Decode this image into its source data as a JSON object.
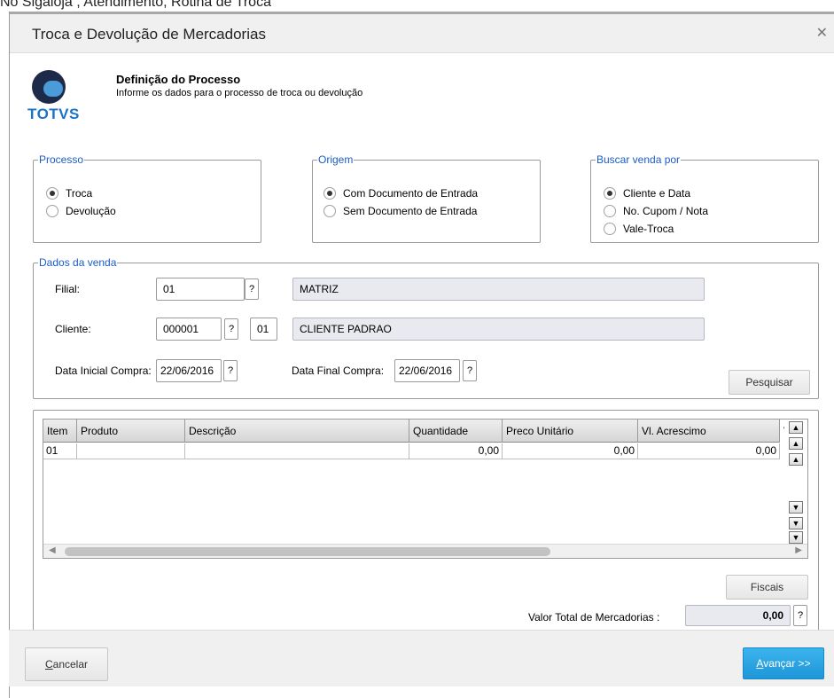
{
  "background": {
    "caption": "No Sigaloja , Atendimento, Rotina de Troca"
  },
  "dialog": {
    "title": "Troca e Devolução de Mercadorias"
  },
  "brand": {
    "logo_text": "TOTVS",
    "primary_color": "#1a73c8",
    "accent_color": "#1e96d8"
  },
  "step": {
    "title": "Definição do Processo",
    "subtitle": "Informe os dados para o processo de troca ou devolução"
  },
  "processo": {
    "legend": "Processo",
    "options": [
      {
        "label": "Troca",
        "selected": true
      },
      {
        "label": "Devolução",
        "selected": false
      }
    ]
  },
  "origem": {
    "legend": "Origem",
    "options": [
      {
        "label": "Com Documento de Entrada",
        "selected": true
      },
      {
        "label": "Sem Documento de Entrada",
        "selected": false
      }
    ]
  },
  "buscar": {
    "legend": "Buscar venda por",
    "options": [
      {
        "label": "Cliente e Data",
        "selected": true
      },
      {
        "label": "No. Cupom / Nota",
        "selected": false
      },
      {
        "label": "Vale-Troca",
        "selected": false
      }
    ]
  },
  "dados": {
    "legend": "Dados da venda",
    "filial_label": "Filial:",
    "filial_value": "01",
    "filial_name": "MATRIZ",
    "cliente_label": "Cliente:",
    "cliente_value": "000001",
    "loja_value": "01",
    "cliente_name": "CLIENTE PADRAO",
    "data_ini_label": "Data Inicial Compra:",
    "data_ini_value": "22/06/2016",
    "data_fim_label": "Data Final Compra:",
    "data_fim_value": "22/06/2016",
    "help_label": "?",
    "search_button": "Pesquisar"
  },
  "grid": {
    "columns": [
      "Item",
      "Produto",
      "Descrição",
      "Quantidade",
      "Preco Unitário",
      "Vl. Acrescimo",
      "V"
    ],
    "rows": [
      {
        "item": "01",
        "produto": "",
        "descricao": "",
        "quantidade": "0,00",
        "preco": "0,00",
        "acrescimo": "0,00"
      }
    ]
  },
  "fiscais_button": "Fiscais",
  "total": {
    "label": "Valor Total de Mercadorias :",
    "value": "0,00"
  },
  "footer": {
    "cancel_accel": "C",
    "cancel_rest": "ancelar",
    "next_accel": "A",
    "next_rest": "vançar >>"
  }
}
